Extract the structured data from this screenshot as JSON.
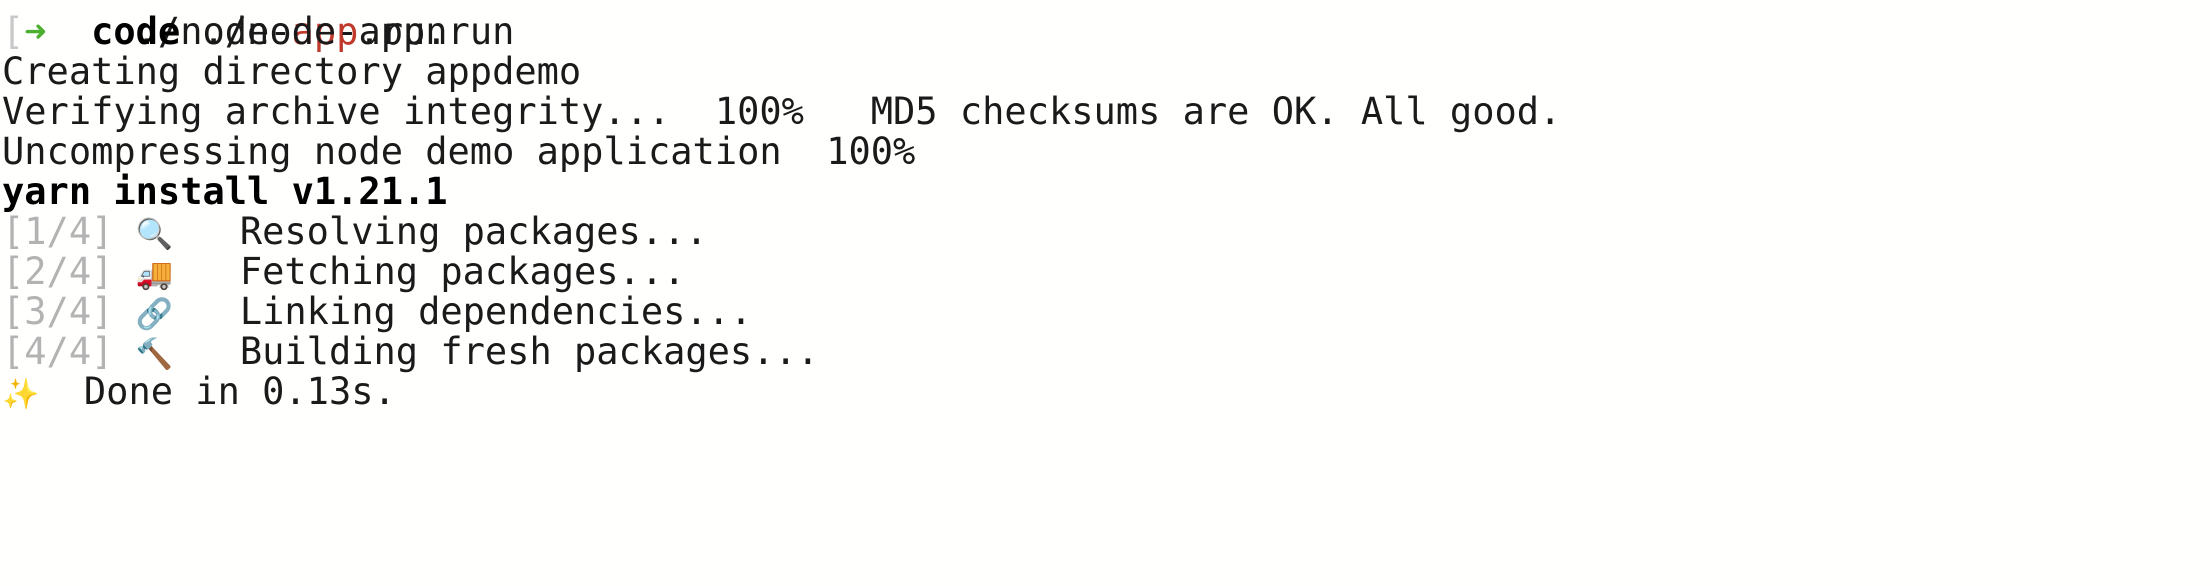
{
  "terminal": {
    "background_color": "#fffffe",
    "foreground_color": "#1a1a1a",
    "gray_color": "#b3b3b3",
    "green_color": "#4caf2f",
    "cyan_color": "#4ab3c4",
    "font_size_px": 37,
    "line_height_px": 40,
    "clipped_top_line": {
      "note": "partially scrolled-out line at very top of viewport",
      "text_before": "./node-",
      "text_highlight": "app",
      "text_after": ".run"
    },
    "lines": [
      {
        "name": "prompt-line",
        "segments": [
          {
            "text": "[",
            "style": "bracket"
          },
          {
            "text": "➜",
            "style": "green"
          },
          {
            "text": "  ",
            "style": "default"
          },
          {
            "text": "code",
            "style": "cyan-bold"
          },
          {
            "text": " ./node-app.run",
            "style": "default"
          }
        ]
      },
      {
        "name": "creating-directory-line",
        "segments": [
          {
            "text": "Creating directory appdemo",
            "style": "default"
          }
        ]
      },
      {
        "name": "verify-integrity-line",
        "segments": [
          {
            "text": "Verifying archive integrity...  100%   MD5 checksums are OK. All good.",
            "style": "default"
          }
        ]
      },
      {
        "name": "uncompressing-line",
        "segments": [
          {
            "text": "Uncompressing node demo application  100%",
            "style": "default"
          }
        ]
      },
      {
        "name": "yarn-version-line",
        "segments": [
          {
            "text": "yarn install v1.21.1",
            "style": "bold"
          }
        ]
      },
      {
        "name": "step-1-resolving-line",
        "segments": [
          {
            "text": "[1/4]",
            "style": "gray"
          },
          {
            "text": " ",
            "style": "default"
          },
          {
            "text": "🔍",
            "style": "emoji",
            "icon": "magnifying-glass-icon"
          },
          {
            "text": "   Resolving packages...",
            "style": "default"
          }
        ]
      },
      {
        "name": "step-2-fetching-line",
        "segments": [
          {
            "text": "[2/4]",
            "style": "gray"
          },
          {
            "text": " ",
            "style": "default"
          },
          {
            "text": "🚚",
            "style": "emoji",
            "icon": "delivery-truck-icon"
          },
          {
            "text": "   Fetching packages...",
            "style": "default"
          }
        ]
      },
      {
        "name": "step-3-linking-line",
        "segments": [
          {
            "text": "[3/4]",
            "style": "gray"
          },
          {
            "text": " ",
            "style": "default"
          },
          {
            "text": "🔗",
            "style": "emoji",
            "icon": "link-chain-icon"
          },
          {
            "text": "   Linking dependencies...",
            "style": "default"
          }
        ]
      },
      {
        "name": "step-4-building-line",
        "segments": [
          {
            "text": "[4/4]",
            "style": "gray"
          },
          {
            "text": " ",
            "style": "default"
          },
          {
            "text": "🔨",
            "style": "emoji",
            "icon": "hammer-icon"
          },
          {
            "text": "   Building fresh packages...",
            "style": "default"
          }
        ]
      },
      {
        "name": "done-line",
        "segments": [
          {
            "text": "✨",
            "style": "emoji",
            "icon": "sparkles-icon"
          },
          {
            "text": "  Done in 0.13s.",
            "style": "default"
          }
        ]
      }
    ]
  }
}
